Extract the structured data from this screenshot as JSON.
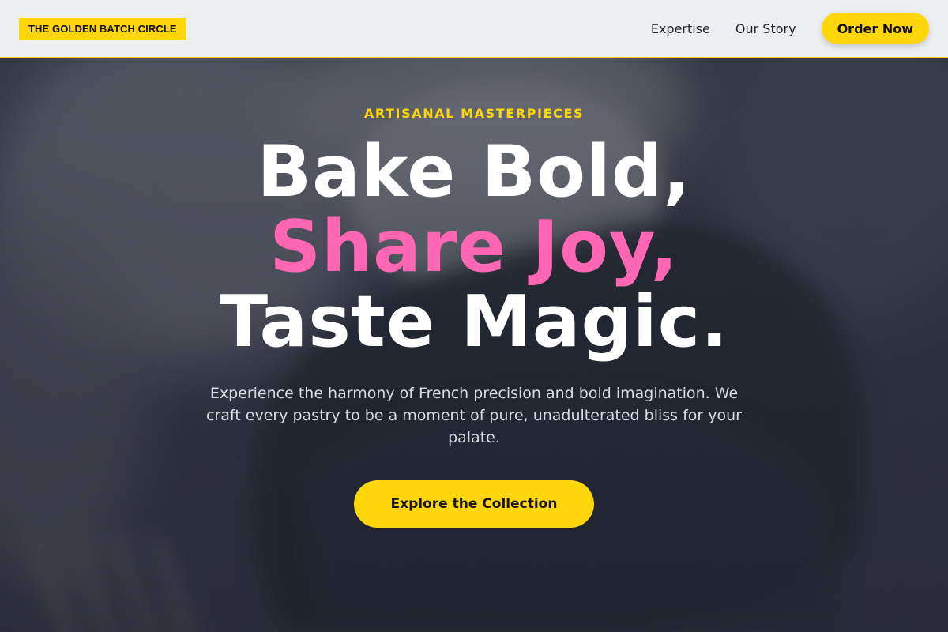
{
  "header": {
    "logo": "THE GOLDEN BATCH CIRCLE",
    "nav": [
      {
        "label": "Expertise"
      },
      {
        "label": "Our Story"
      }
    ],
    "cta_label": "Order Now"
  },
  "hero": {
    "eyebrow": "ARTISANAL MASTERPIECES",
    "headline": [
      "Bake Bold,",
      "Share Joy,",
      "Taste Magic."
    ],
    "subtitle": "Experience the harmony of French precision and bold imagination. We craft every pastry to be a moment of pure, unadulterated bliss for your palate.",
    "cta_label": "Explore the Collection"
  },
  "colors": {
    "accent": "#ffd60a",
    "highlight": "#ff66b3",
    "header_bg": "#eeeff1"
  }
}
